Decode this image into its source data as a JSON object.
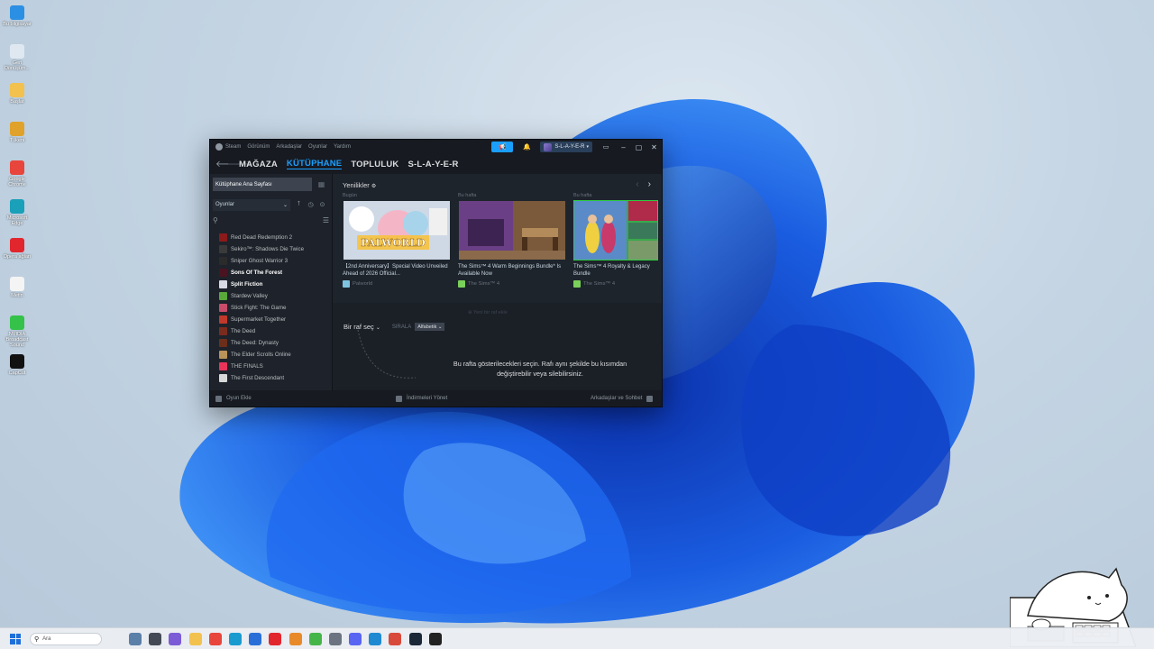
{
  "desktop": {
    "icons": [
      {
        "label": "Bu bilgisayar",
        "icon": "computer-icon",
        "color": "#2b8fe3"
      },
      {
        "label": "Geri Dönüşüm...",
        "icon": "recycle-bin-icon",
        "color": "#dfe8f1"
      },
      {
        "label": "Başlat",
        "icon": "folder-icon",
        "color": "#f2c14e"
      },
      {
        "label": "Tükeni",
        "icon": "card-icon",
        "color": "#e0a22a"
      },
      {
        "label": "Google Chrome",
        "icon": "chrome-icon",
        "color": "#e8453c"
      },
      {
        "label": "Microsoft Edge",
        "icon": "edge-icon",
        "color": "#1aa0b8"
      },
      {
        "label": "Opera ağları",
        "icon": "opera-icon",
        "color": "#e1262d"
      },
      {
        "label": "Metin",
        "icon": "document-icon",
        "color": "#f4f4f4"
      },
      {
        "label": "NVIDIA Broadcast Sound",
        "icon": "nvidia-icon",
        "color": "#35c24a"
      },
      {
        "label": "CapCut",
        "icon": "capcut-icon",
        "color": "#111111"
      }
    ]
  },
  "steam": {
    "menu": [
      "Steam",
      "Görünüm",
      "Arkadaşlar",
      "Oyunlar",
      "Yardım"
    ],
    "user": "S-L-A-Y-E-R",
    "nav": [
      "MAĞAZA",
      "KÜTÜPHANE",
      "TOPLULUK",
      "S-L-A-Y-E-R"
    ],
    "sidebar": {
      "home": "Kütüphane Ana Sayfası",
      "filter": "Oyunlar",
      "games": [
        {
          "name": "Red Dead Redemption 2",
          "color": "#8b1a1a",
          "bold": false
        },
        {
          "name": "Sekiro™: Shadows Die Twice",
          "color": "#3a3a3a",
          "bold": false
        },
        {
          "name": "Sniper Ghost Warrior 3",
          "color": "#2b2b2b",
          "bold": false
        },
        {
          "name": "Sons Of The Forest",
          "color": "#4a1320",
          "bold": true
        },
        {
          "name": "Split Fiction",
          "color": "#d9d9e6",
          "bold": true
        },
        {
          "name": "Stardew Valley",
          "color": "#5aa83a",
          "bold": false
        },
        {
          "name": "Stick Fight: The Game",
          "color": "#c84c6a",
          "bold": false
        },
        {
          "name": "Supermarket Together",
          "color": "#c0392b",
          "bold": false
        },
        {
          "name": "The Deed",
          "color": "#7a2b1e",
          "bold": false
        },
        {
          "name": "The Deed: Dynasty",
          "color": "#6b2e1a",
          "bold": false
        },
        {
          "name": "The Elder Scrolls Online",
          "color": "#b8935a",
          "bold": false
        },
        {
          "name": "THE FINALS",
          "color": "#e8345a",
          "bold": false
        },
        {
          "name": "The First Descendant",
          "color": "#d8d8d8",
          "bold": false
        }
      ]
    },
    "news": {
      "heading": "Yenilikler",
      "cards": [
        {
          "when": "Bugün",
          "title": "【2nd Anniversary】Special Video Unveiled Ahead of 2026 Official...",
          "game": "Palworld"
        },
        {
          "when": "Bu hafta",
          "title": "The Sims™ 4 Warm Beginnings Bundle* Is Available Now",
          "game": "The Sims™ 4"
        },
        {
          "when": "Bu hafta",
          "title": "The Sims™ 4 Royalty & Legacy Bundle",
          "game": "The Sims™ 4"
        }
      ]
    },
    "shelf": {
      "add_shelf": "Yeni bir raf ekle",
      "pick": "Bir raf seç",
      "sort_label": "SIRALA",
      "sort_value": "Alfabetik",
      "message": "Bu rafta gösterilecekleri seçin. Rafı aynı şekilde bu kısımdan değiştirebilir veya silebilirsiniz."
    },
    "footer": {
      "add_game": "Oyun Ekle",
      "downloads": "İndirmeleri Yönet",
      "friends": "Arkadaşlar ve Sohbet"
    }
  },
  "taskbar": {
    "search_placeholder": "Ara",
    "apps": [
      {
        "icon": "photos-icon",
        "color": "#5a7fa8"
      },
      {
        "icon": "taskview-icon",
        "color": "#444a55"
      },
      {
        "icon": "copilot-icon",
        "color": "#7b5cd6"
      },
      {
        "icon": "explorer-icon",
        "color": "#f2c14e"
      },
      {
        "icon": "chrome-icon",
        "color": "#e8453c"
      },
      {
        "icon": "edge-icon",
        "color": "#1a9bd0"
      },
      {
        "icon": "store-icon",
        "color": "#2a6fd8"
      },
      {
        "icon": "opera-icon",
        "color": "#e1262d"
      },
      {
        "icon": "blender-icon",
        "color": "#e88a2a"
      },
      {
        "icon": "nvidia-icon",
        "color": "#45b54a"
      },
      {
        "icon": "settings-icon",
        "color": "#6b7480"
      },
      {
        "icon": "discord-icon",
        "color": "#5865f2"
      },
      {
        "icon": "vscode-icon",
        "color": "#1f8ad2"
      },
      {
        "icon": "chrome-alt-icon",
        "color": "#d84a3b"
      },
      {
        "icon": "steam-icon",
        "color": "#1b2838"
      },
      {
        "icon": "epic-icon",
        "color": "#222222"
      }
    ]
  }
}
